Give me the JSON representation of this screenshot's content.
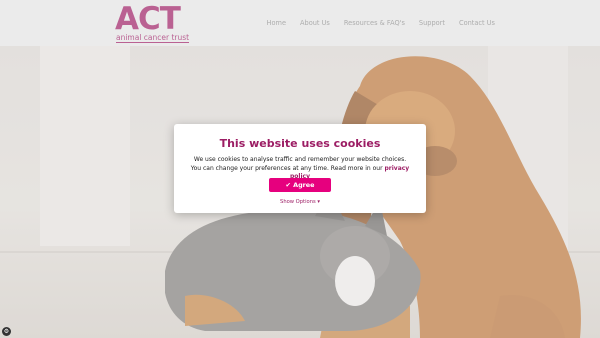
{
  "brand": {
    "logo_text": "ACT",
    "logo_subtitle": "animal cancer trust",
    "color": "#9c1d64"
  },
  "nav": {
    "items": [
      {
        "label": "Home"
      },
      {
        "label": "About Us"
      },
      {
        "label": "Resources & FAQ's"
      },
      {
        "label": "Support"
      },
      {
        "label": "Contact Us"
      }
    ]
  },
  "cookie": {
    "title": "This website uses cookies",
    "body": "We use cookies to analyse traffic and remember your website choices. You can change your preferences at any time. Read more in our",
    "link_label": "privacy policy",
    "agree_label": "Agree",
    "agree_icon": "check-icon",
    "show_options_label": "Show Options",
    "show_options_icon": "caret-down-icon",
    "accent_color": "#e6007e"
  },
  "corner_widget": {
    "icon": "cookie-settings-icon"
  }
}
